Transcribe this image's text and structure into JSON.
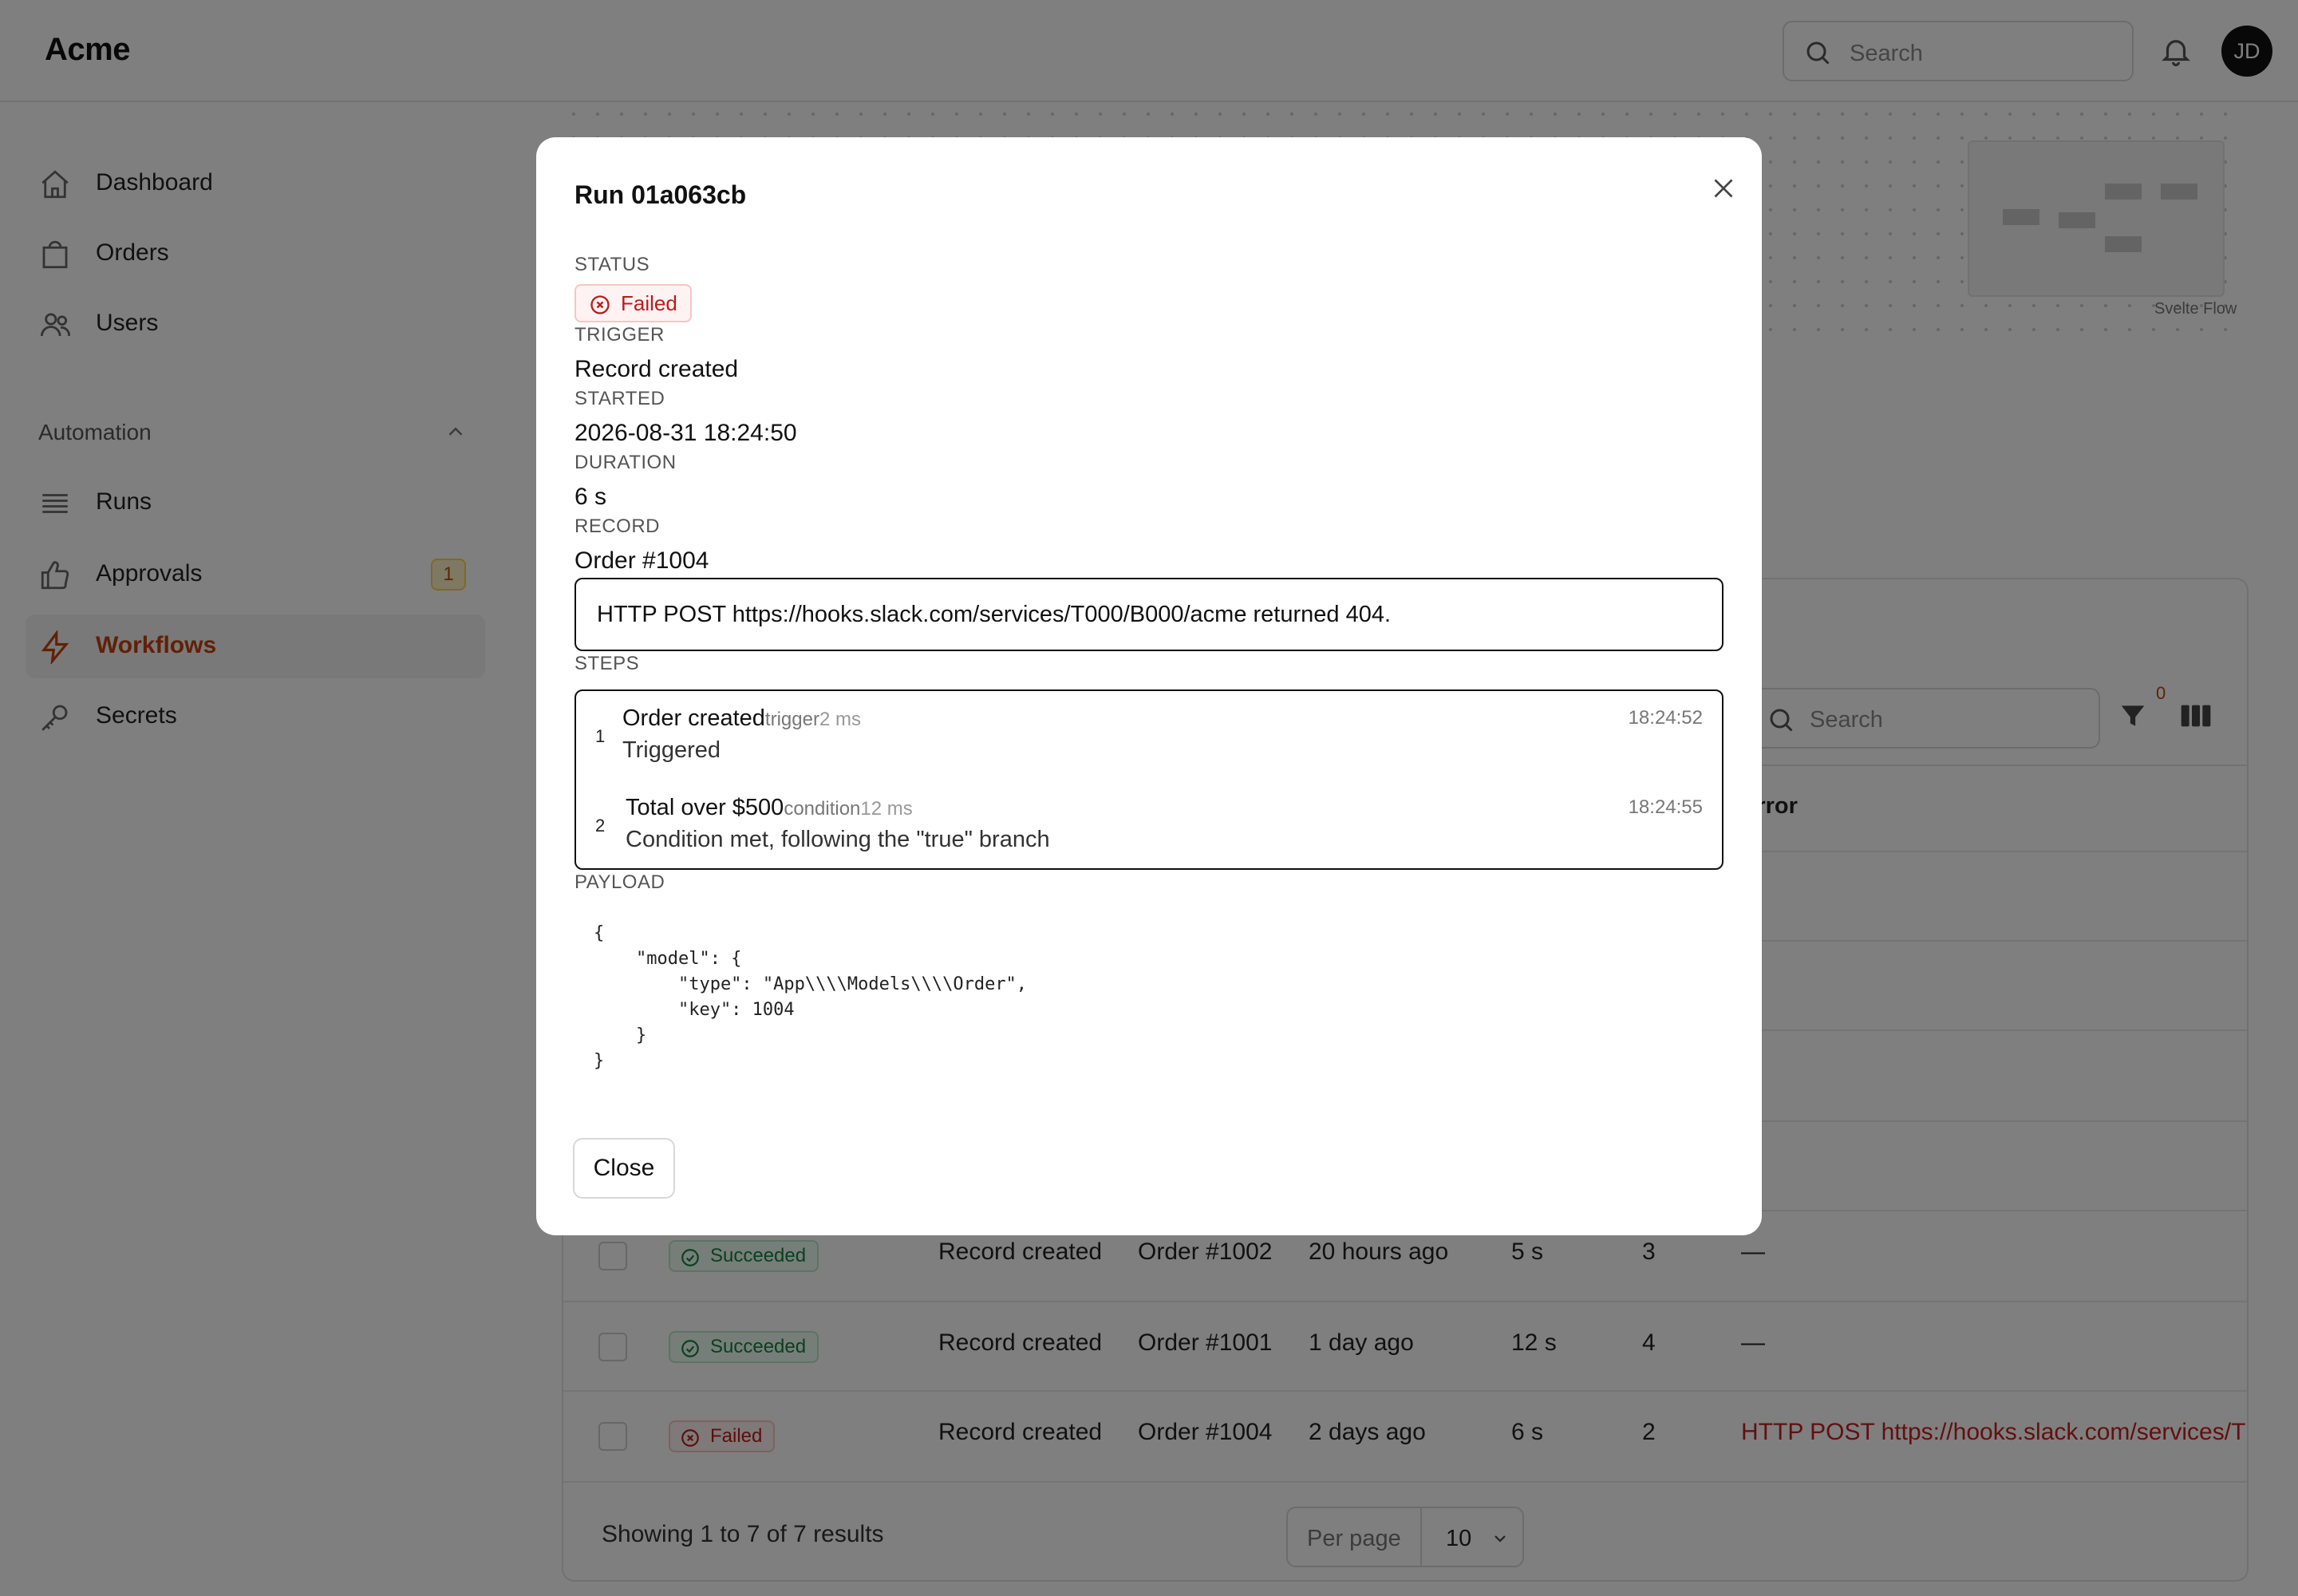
{
  "app": {
    "name": "Acme"
  },
  "header": {
    "search_placeholder": "Search",
    "avatar_initials": "JD"
  },
  "sidebar": {
    "items": [
      {
        "label": "Dashboard",
        "icon": "home-icon"
      },
      {
        "label": "Orders",
        "icon": "shopping-bag-icon"
      },
      {
        "label": "Users",
        "icon": "users-icon"
      }
    ],
    "section": {
      "label": "Automation",
      "expanded": true
    },
    "automation_items": [
      {
        "label": "Runs",
        "icon": "list-icon"
      },
      {
        "label": "Approvals",
        "icon": "thumbs-up-icon",
        "badge": "1"
      },
      {
        "label": "Workflows",
        "icon": "bolt-icon",
        "active": true
      },
      {
        "label": "Secrets",
        "icon": "key-icon"
      }
    ]
  },
  "canvas": {
    "label": "Svelte Flow"
  },
  "table": {
    "search_placeholder": "Search",
    "filter_count": "0",
    "header_error": "Error",
    "rows": [
      {
        "status": "Succeeded",
        "trigger": "Record created",
        "record": "Order #1002",
        "started": "20 hours ago",
        "duration": "5 s",
        "steps": "3",
        "error": "—"
      },
      {
        "status": "Succeeded",
        "trigger": "Record created",
        "record": "Order #1001",
        "started": "1 day ago",
        "duration": "12 s",
        "steps": "4",
        "error": "—"
      },
      {
        "status": "Failed",
        "trigger": "Record created",
        "record": "Order #1004",
        "started": "2 days ago",
        "duration": "6 s",
        "steps": "2",
        "error": "HTTP POST https://hooks.slack.com/services/T"
      }
    ],
    "footer": {
      "summary": "Showing 1 to 7 of 7 results",
      "per_page_label": "Per page",
      "per_page_value": "10"
    }
  },
  "modal": {
    "title": "Run 01a063cb",
    "status_label": "STATUS",
    "status_value": "Failed",
    "trigger_label": "TRIGGER",
    "trigger_value": "Record created",
    "started_label": "STARTED",
    "started_value": "2026-08-31 18:24:50",
    "duration_label": "DURATION",
    "duration_value": "6 s",
    "record_label": "RECORD",
    "record_value": "Order #1004",
    "error_message": "HTTP POST https://hooks.slack.com/services/T000/B000/acme returned 404.",
    "steps_label": "STEPS",
    "steps": [
      {
        "number": "1",
        "name": "Order created",
        "type": "trigger",
        "duration": "2 ms",
        "detail": "Triggered",
        "time": "18:24:52"
      },
      {
        "number": "2",
        "name": "Total over $500",
        "type": "condition",
        "duration": "12 ms",
        "detail": "Condition met, following the \"true\" branch",
        "time": "18:24:55"
      }
    ],
    "payload_label": "PAYLOAD",
    "payload": "{\n    \"model\": {\n        \"type\": \"App\\\\\\\\Models\\\\\\\\Order\",\n        \"key\": 1004\n    }\n}",
    "close_label": "Close"
  },
  "colors": {
    "accent": "#c2410c",
    "failed": "#b91c1c",
    "succeeded": "#15803d"
  }
}
